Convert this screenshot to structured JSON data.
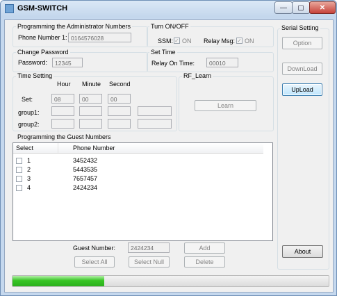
{
  "window": {
    "title": "GSM-SWITCH",
    "minimize_icon": "minimize-icon",
    "maximize_icon": "maximize-icon",
    "close_icon": "close-icon"
  },
  "admin": {
    "legend": "Programming the Administrator Numbers",
    "phone_label": "Phone Number 1:",
    "phone_value": "0164576028"
  },
  "turn": {
    "legend": "Turn ON/OFF",
    "ssm_label": "SSM:",
    "ssm_option": "ON",
    "relay_label": "Relay Msg:",
    "relay_option": "ON",
    "ssm_checked": true,
    "relay_checked": true
  },
  "password": {
    "legend": "Change Password",
    "label": "Password:",
    "value": "12345"
  },
  "settime": {
    "legend": "Set Time",
    "relay_label": "Relay On Time:",
    "relay_value": "00010"
  },
  "timesetting": {
    "legend": "Time Setting",
    "headers": [
      "Hour",
      "Minute",
      "Second"
    ],
    "rows": [
      {
        "label": "Set:",
        "values": [
          "08",
          "00",
          "00"
        ]
      },
      {
        "label": "group1:",
        "values": [
          "",
          "",
          "",
          ""
        ]
      },
      {
        "label": "group2:",
        "values": [
          "",
          "",
          "",
          ""
        ]
      }
    ]
  },
  "rf": {
    "legend": "RF_Learn",
    "learn_button": "Learn"
  },
  "serial": {
    "legend": "Serial Setting",
    "option_button": "Option",
    "download_button": "DownLoad",
    "upload_button": "UpLoad",
    "about_button": "About"
  },
  "guest": {
    "legend": "Programming the Guest Numbers",
    "columns": [
      "Select",
      "Phone Number"
    ],
    "rows": [
      {
        "index": "1",
        "phone": "3452432"
      },
      {
        "index": "2",
        "phone": "5443535"
      },
      {
        "index": "3",
        "phone": "7657457"
      },
      {
        "index": "4",
        "phone": "2424234"
      }
    ],
    "number_label": "Guest Number:",
    "number_value": "2424234",
    "add_button": "Add",
    "select_all_button": "Select All",
    "select_null_button": "Select Null",
    "delete_button": "Delete"
  },
  "progress": {
    "fraction": 0.29,
    "color": "#37c524"
  }
}
